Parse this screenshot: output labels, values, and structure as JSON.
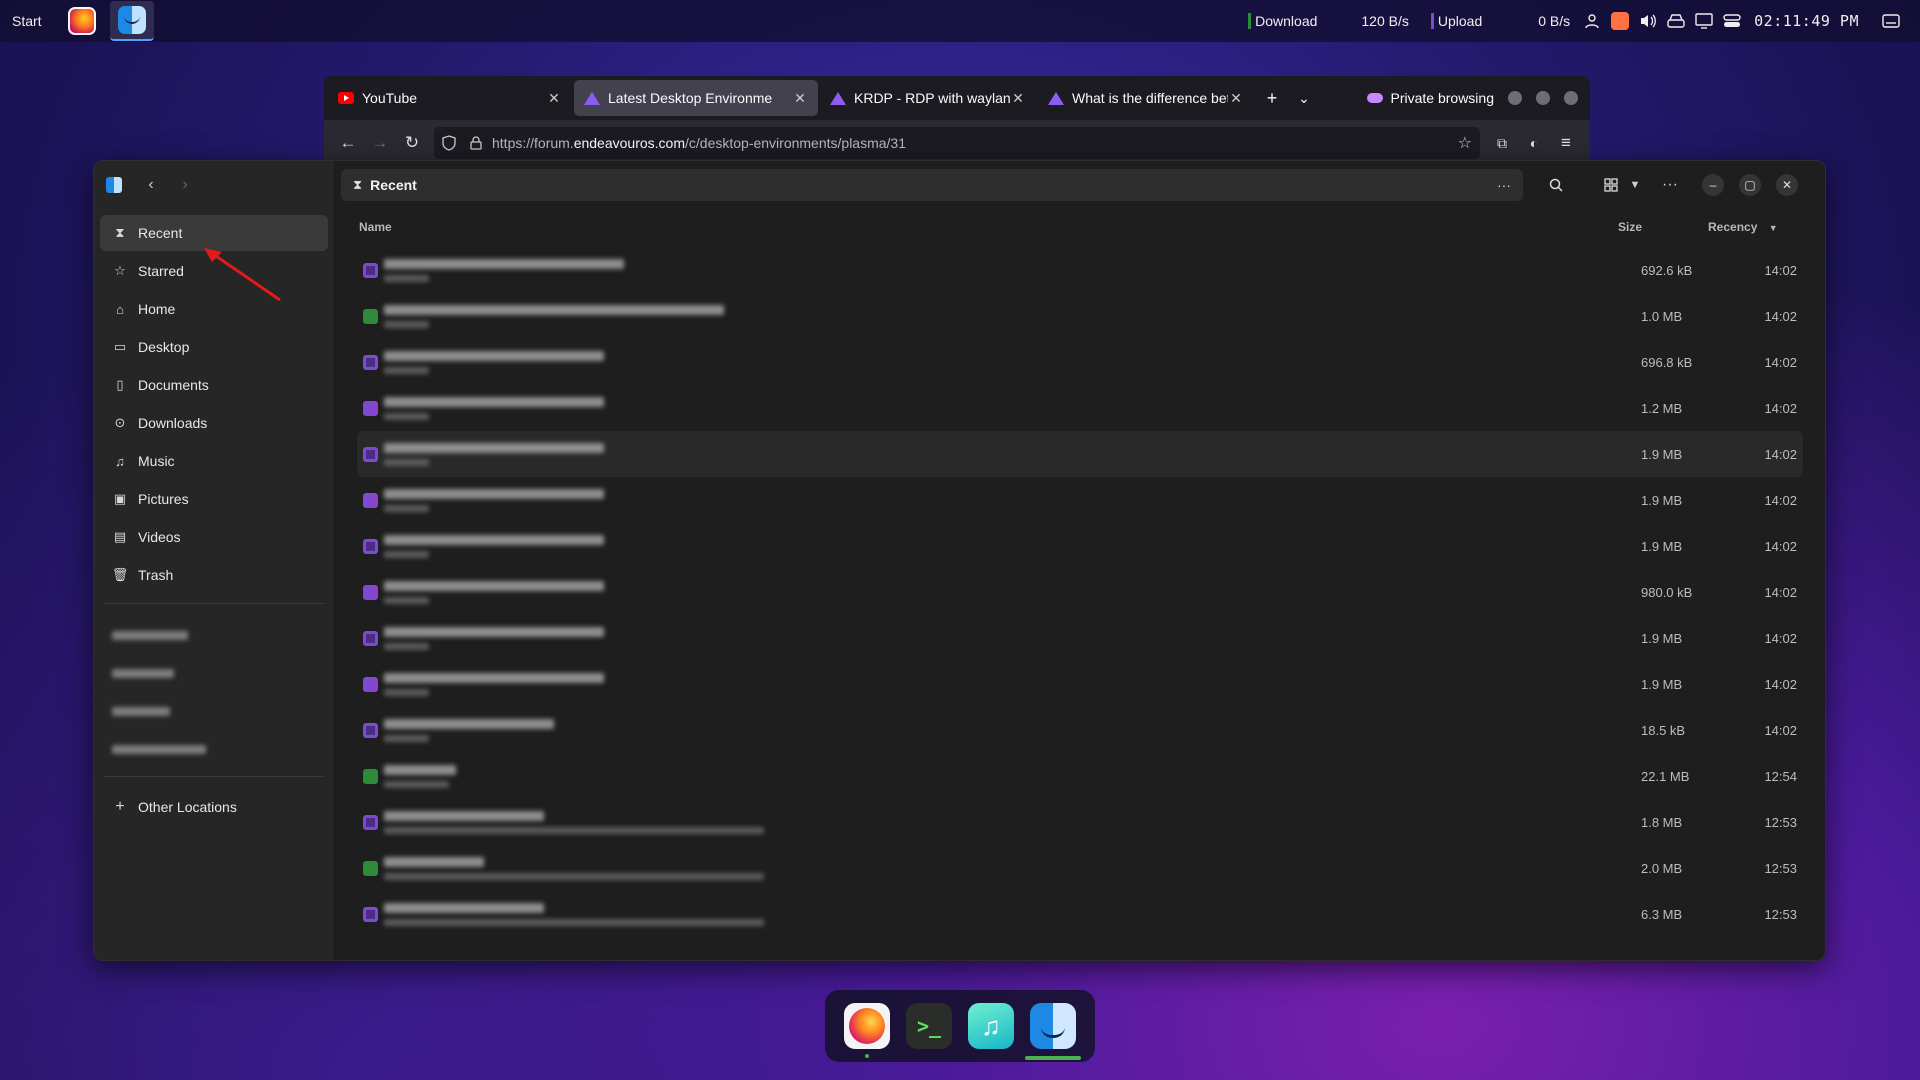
{
  "panel": {
    "start_label": "Start",
    "download_label": "Download",
    "download_speed": "120 B/s",
    "upload_label": "Upload",
    "upload_speed": "0 B/s",
    "clock": "02:11:49 PM",
    "download_bar_color": "#2e8b3a",
    "upload_bar_color": "#7b4bd1"
  },
  "browser": {
    "tabs": [
      {
        "label": "YouTube",
        "favicon": "youtube-icon",
        "active": false
      },
      {
        "label": "Latest Desktop Environme",
        "favicon": "endeavouros-icon",
        "active": true
      },
      {
        "label": "KRDP - RDP with wayland",
        "favicon": "endeavouros-icon",
        "active": false
      },
      {
        "label": "What is the difference bet",
        "favicon": "endeavouros-icon",
        "active": false
      }
    ],
    "private_label": "Private browsing",
    "url_prefix": "https://forum.",
    "url_host": "endeavouros.com",
    "url_path": "/c/desktop-environments/plasma/31"
  },
  "files": {
    "title": "Recent",
    "sidebar": {
      "places": [
        {
          "label": "Recent",
          "icon": "recent-icon",
          "selected": true
        },
        {
          "label": "Starred",
          "icon": "star-icon"
        },
        {
          "label": "Home",
          "icon": "home-icon"
        },
        {
          "label": "Desktop",
          "icon": "desktop-icon"
        },
        {
          "label": "Documents",
          "icon": "document-icon"
        },
        {
          "label": "Downloads",
          "icon": "download-icon"
        },
        {
          "label": "Music",
          "icon": "music-icon"
        },
        {
          "label": "Pictures",
          "icon": "picture-icon"
        },
        {
          "label": "Videos",
          "icon": "video-icon"
        },
        {
          "label": "Trash",
          "icon": "trash-icon"
        }
      ],
      "other_locations": "Other Locations"
    },
    "columns": {
      "name": "Name",
      "size": "Size",
      "recency": "Recency"
    },
    "rows": [
      {
        "size": "692.6 kB",
        "time": "14:02",
        "icon": "purple"
      },
      {
        "size": "1.0 MB",
        "time": "14:02",
        "icon": "green"
      },
      {
        "size": "696.8 kB",
        "time": "14:02",
        "icon": "purple"
      },
      {
        "size": "1.2 MB",
        "time": "14:02",
        "icon": "mixed"
      },
      {
        "size": "1.9 MB",
        "time": "14:02",
        "icon": "purple"
      },
      {
        "size": "1.9 MB",
        "time": "14:02",
        "icon": "mixed"
      },
      {
        "size": "1.9 MB",
        "time": "14:02",
        "icon": "purple"
      },
      {
        "size": "980.0 kB",
        "time": "14:02",
        "icon": "mixed"
      },
      {
        "size": "1.9 MB",
        "time": "14:02",
        "icon": "purple"
      },
      {
        "size": "1.9 MB",
        "time": "14:02",
        "icon": "mixed"
      },
      {
        "size": "18.5 kB",
        "time": "14:02",
        "icon": "purple"
      },
      {
        "size": "22.1 MB",
        "time": "12:54",
        "icon": "green"
      },
      {
        "size": "1.8 MB",
        "time": "12:53",
        "icon": "purple"
      },
      {
        "size": "2.0 MB",
        "time": "12:53",
        "icon": "green"
      },
      {
        "size": "6.3 MB",
        "time": "12:53",
        "icon": "purple"
      }
    ]
  },
  "dock": {
    "apps": [
      "firefox-icon",
      "terminal-icon",
      "music-player-icon",
      "file-manager-icon"
    ],
    "terminal_glyph": ">_",
    "music_glyph": "♫"
  }
}
